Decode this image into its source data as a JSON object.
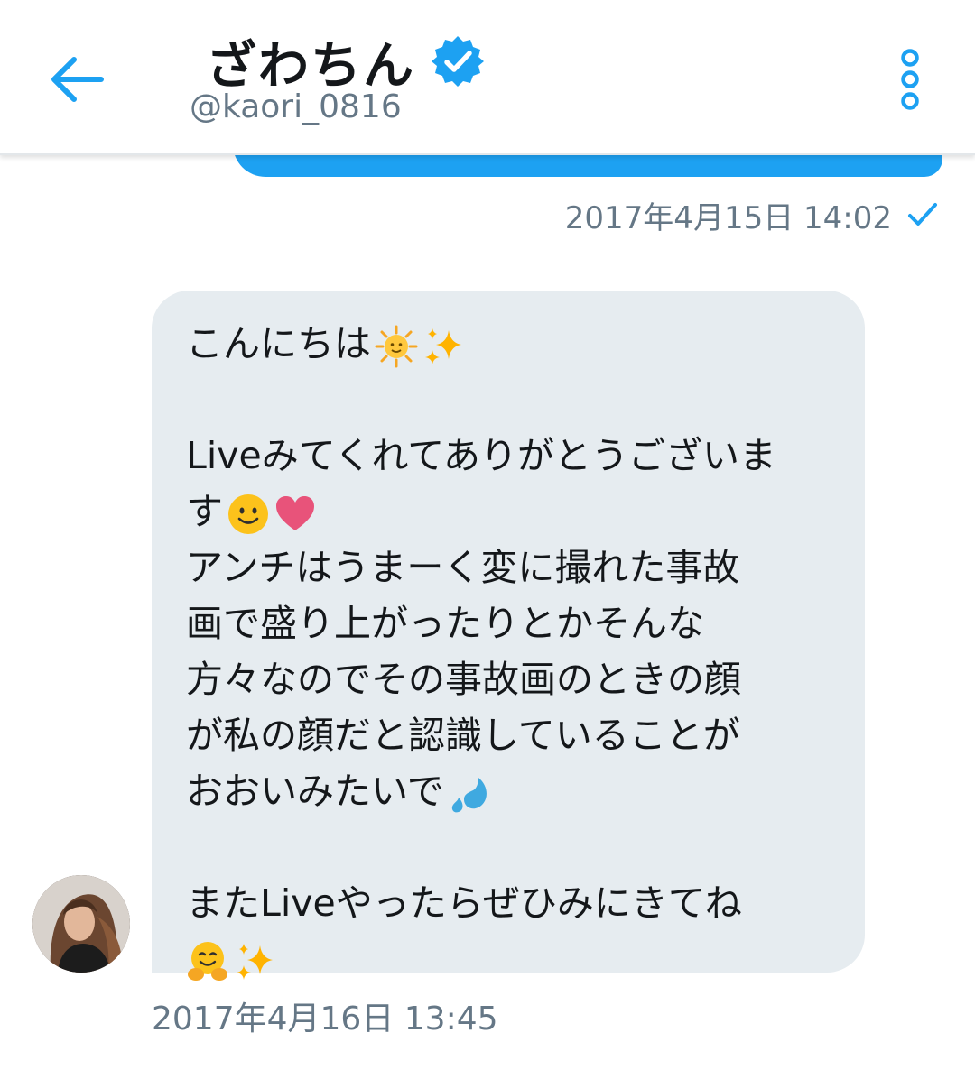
{
  "header": {
    "name": "ざわちん",
    "handle": "@kaori_0816"
  },
  "sent": {
    "timestamp": "2017年4月15日 14:02"
  },
  "received": {
    "timestamp": "2017年4月16日 13:45",
    "lines": [
      "こんにちは",
      "",
      "Liveみてくれてありがとうございま",
      "す",
      "アンチはうまーく変に撮れた事故",
      "画で盛り上がったりとかそんな",
      "方々なのでその事故画のときの顔",
      "が私の顔だと認識していることが",
      "おおいみたいで",
      "",
      "またLiveやったらぜひみにきてね",
      ""
    ]
  },
  "icons": {
    "back": "back-arrow-icon",
    "verified": "verified-badge-icon",
    "more": "more-vertical-icon",
    "read": "checkmark-icon",
    "sun": "sun-face-emoji",
    "sparkles": "sparkles-emoji",
    "smile": "smiling-face-emoji",
    "heart": "pink-heart-emoji",
    "sweat": "sweat-droplets-emoji",
    "hug": "hugging-face-emoji"
  },
  "colors": {
    "accent": "#1da1f2",
    "bubble_received": "#e6ecf0",
    "secondary_text": "#657786"
  }
}
